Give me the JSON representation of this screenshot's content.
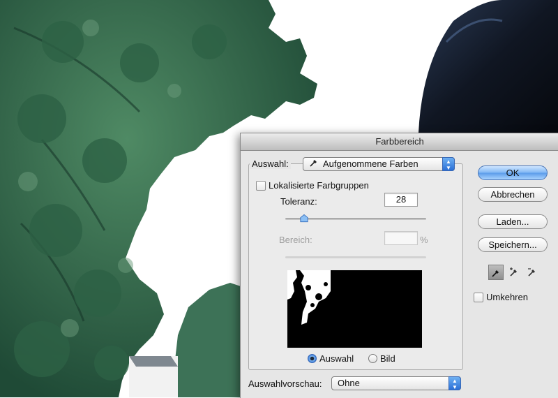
{
  "dialog": {
    "title": "Farbbereich",
    "selection_label": "Auswahl:",
    "selection_value": "Aufgenommene Farben",
    "localized_label": "Lokalisierte Farbgruppen",
    "localized_checked": false,
    "tolerance_label": "Toleranz:",
    "tolerance_value": "28",
    "range_label": "Bereich:",
    "range_value": "",
    "range_unit": "%",
    "preview_mode_selection": "Auswahl",
    "preview_mode_image": "Bild",
    "preview_mode_selected": "Auswahl",
    "selection_preview_label": "Auswahlvorschau:",
    "selection_preview_value": "Ohne",
    "buttons": {
      "ok": "OK",
      "cancel": "Abbrechen",
      "load": "Laden...",
      "save": "Speichern..."
    },
    "invert_label": "Umkehren",
    "invert_checked": false,
    "tools": [
      "eyedropper-icon",
      "eyedropper-plus-icon",
      "eyedropper-minus-icon"
    ],
    "active_tool": "eyedropper-icon"
  },
  "colors": {
    "ok_button": "#6aa6ee",
    "dialog_bg": "#e6e6e6",
    "popup_arrows": "#2a6fd6"
  }
}
